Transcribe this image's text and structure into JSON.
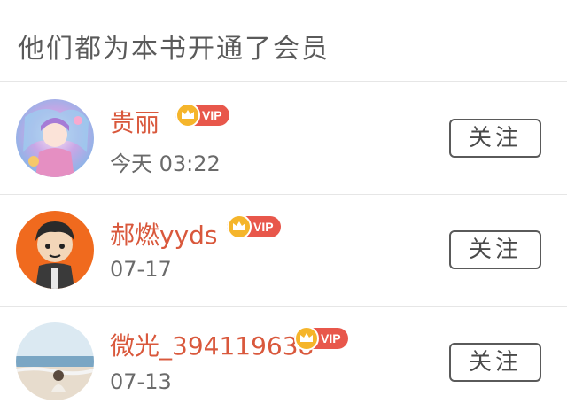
{
  "header": {
    "title": "他们都为本书开通了会员"
  },
  "members": [
    {
      "name": "贵丽",
      "badge": "VIP",
      "time": "今天 03:22",
      "follow_label": "关注"
    },
    {
      "name": "郝燃yyds",
      "badge": "VIP",
      "time": "07-17",
      "follow_label": "关注"
    },
    {
      "name": "微光_394119638",
      "badge": "VIP",
      "time": "07-13",
      "follow_label": "关注"
    }
  ],
  "colors": {
    "name": "#d9583c",
    "vip_badge": "#e8574b",
    "crown": "#f5b52b",
    "divider": "#e6e6e6"
  }
}
